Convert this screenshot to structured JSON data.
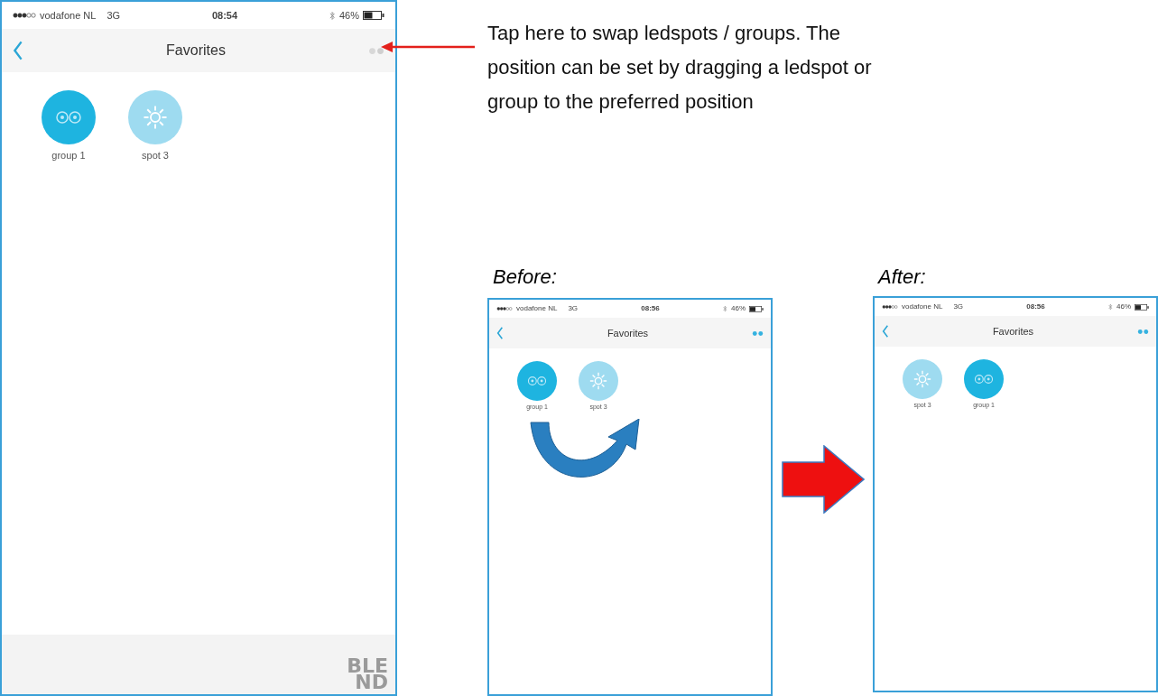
{
  "screens": [
    {
      "kind": "main",
      "status": {
        "carrier": "vodafone NL",
        "network": "3G",
        "time": "08:54",
        "battery": "46%"
      },
      "title": "Favorites",
      "swap_active": false,
      "items": [
        {
          "kind": "group",
          "label": "group 1"
        },
        {
          "kind": "spot",
          "label": "spot 3"
        }
      ],
      "footer_logo": [
        "BLE",
        "ND"
      ]
    },
    {
      "caption": "Before:",
      "kind": "preview",
      "status": {
        "carrier": "vodafone NL",
        "network": "3G",
        "time": "08:56",
        "battery": "46%"
      },
      "title": "Favorites",
      "swap_active": true,
      "items": [
        {
          "kind": "group",
          "label": "group 1"
        },
        {
          "kind": "spot",
          "label": "spot 3"
        }
      ]
    },
    {
      "caption": "After:",
      "kind": "preview",
      "status": {
        "carrier": "vodafone NL",
        "network": "3G",
        "time": "08:56",
        "battery": "46%"
      },
      "title": "Favorites",
      "swap_active": true,
      "items": [
        {
          "kind": "spot",
          "label": "spot 3"
        },
        {
          "kind": "group",
          "label": "group 1"
        }
      ]
    }
  ],
  "annotation": "Tap here to swap ledspots / groups. The position can be set by dragging a ledspot or group to the preferred position"
}
